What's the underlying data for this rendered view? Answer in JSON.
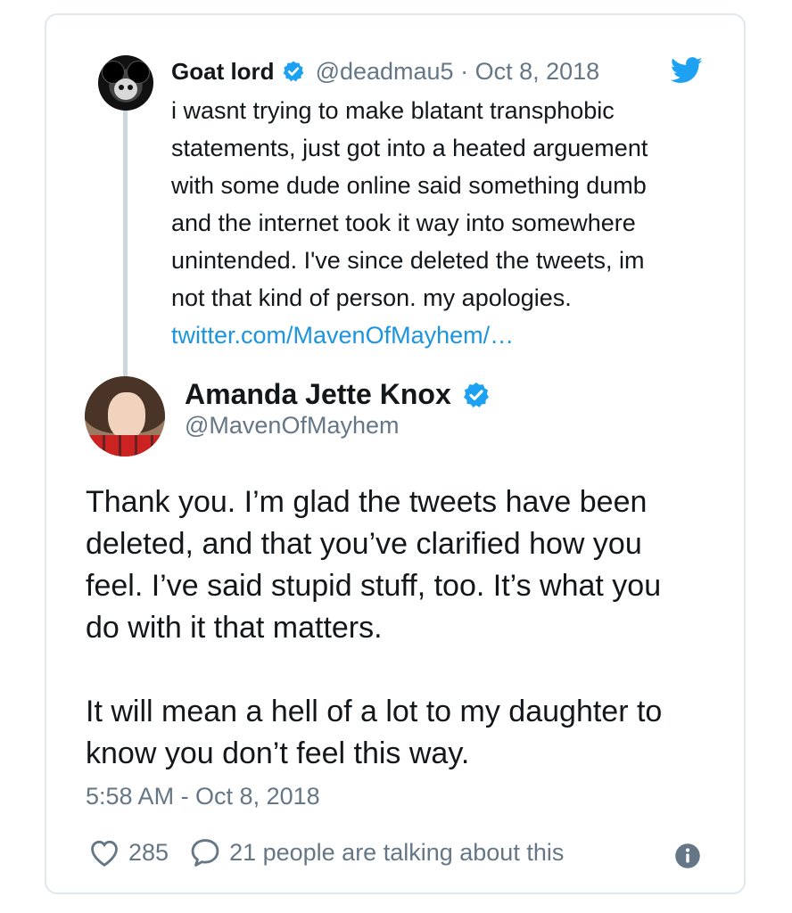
{
  "quoted_tweet": {
    "author_name": "Goat lord",
    "handle_date": "@deadmau5 · Oct 8, 2018",
    "text_lines": [
      "i wasnt trying to make blatant transphobic",
      "statements, just got into a heated arguement",
      "with some dude online said something dumb",
      "and the internet took it way into somewhere",
      "unintended. I've since deleted the tweets, im",
      "not that kind of person. my apologies."
    ],
    "link": "twitter.com/MavenOfMayhem/…"
  },
  "tweet": {
    "author_name": "Amanda Jette Knox",
    "handle": "@MavenOfMayhem",
    "paragraph1_lines": [
      "Thank you. I’m glad the tweets have been",
      "deleted, and that you’ve clarified how you",
      "feel. I’ve said stupid stuff, too. It’s what you",
      "do with it that matters."
    ],
    "paragraph2_lines": [
      "It will mean a hell of a lot to my daughter to",
      "know you don’t feel this way."
    ],
    "timestamp": "5:58 AM - Oct 8, 2018",
    "likes": "285",
    "talking": "21 people are talking about this"
  },
  "icons": {
    "verified": "verified-badge-icon",
    "bird": "twitter-bird-icon",
    "like": "heart-icon",
    "reply": "speech-bubble-icon",
    "info": "info-icon"
  },
  "colors": {
    "link": "#1b95e0",
    "verified": "#1da1f2",
    "secondary_text": "#657786"
  }
}
